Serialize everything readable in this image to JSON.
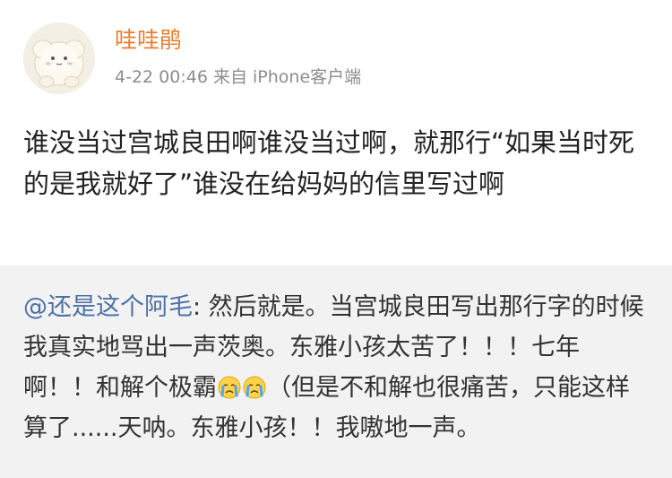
{
  "post": {
    "author": "哇哇鹃",
    "timestamp": "4-22 00:46",
    "source": "来自 iPhone客户端",
    "text": "谁没当过宫城良田啊谁没当过啊，就那行“如果当时死的是我就好了”谁没在给妈妈的信里写过啊"
  },
  "repost": {
    "mention": "@还是这个阿毛",
    "text_before_emoji": ": 然后就是。当宫城良田写出那行字的时候我真实地骂出一声茨奥。东雅小孩太苦了！！！七年啊！！和解个极霸",
    "emojis": [
      "crying-face-icon",
      "crying-face-icon"
    ],
    "text_after_emoji": "（但是不和解也很痛苦，只能这样算了......天呐。东雅小孩！！我嗷地一声。"
  },
  "colors": {
    "username": "#ea7b2b",
    "meta": "#8d8d8d",
    "mention": "#4d71a6",
    "repost_bg": "#f2f2f2"
  }
}
